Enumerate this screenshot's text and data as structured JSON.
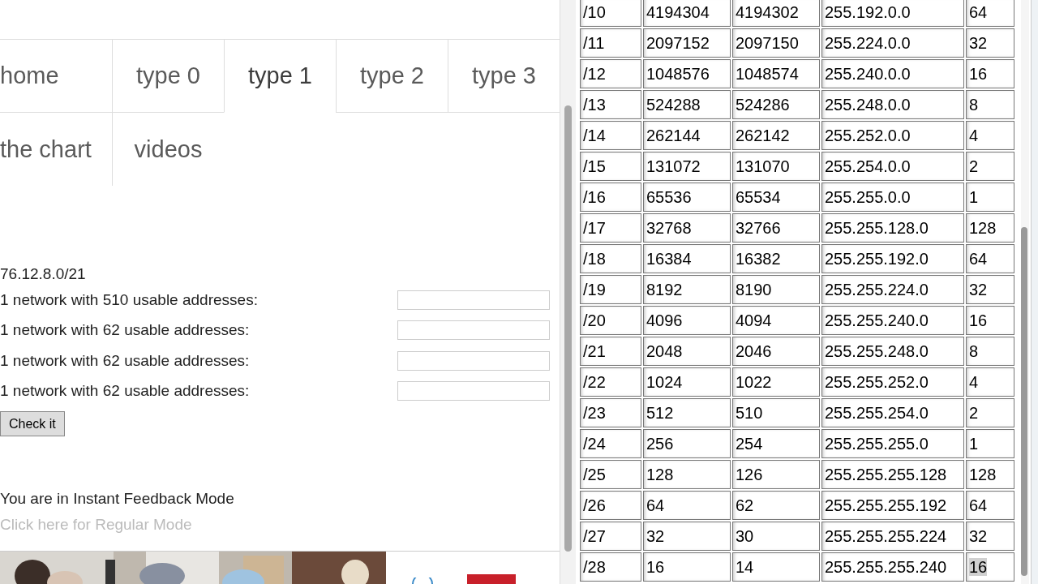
{
  "nav": {
    "tabs": [
      {
        "label": "home",
        "selected": false
      },
      {
        "label": "type 0",
        "selected": false
      },
      {
        "label": "type 1",
        "selected": true
      },
      {
        "label": "type 2",
        "selected": false
      },
      {
        "label": "type 3",
        "selected": false
      },
      {
        "label": "the chart",
        "selected": false
      },
      {
        "label": "videos",
        "selected": false
      }
    ]
  },
  "exercise": {
    "network": "76.12.8.0/21",
    "rows": [
      {
        "label": "1 network with 510 usable addresses:"
      },
      {
        "label": "1 network with 62 usable addresses:"
      },
      {
        "label": "1 network with 62 usable addresses:"
      },
      {
        "label": "1 network with 62 usable addresses:"
      }
    ],
    "button": "Check it",
    "mode_text": "You are in Instant Feedback Mode",
    "mode_link": "Click here for Regular Mode"
  },
  "subnet_table": {
    "rows": [
      {
        "cells": [
          "/10",
          "4194304",
          "4194302",
          "255.192.0.0",
          "64"
        ],
        "highlighted": false
      },
      {
        "cells": [
          "/11",
          "2097152",
          "2097150",
          "255.224.0.0",
          "32"
        ],
        "highlighted": false
      },
      {
        "cells": [
          "/12",
          "1048576",
          "1048574",
          "255.240.0.0",
          "16"
        ],
        "highlighted": false
      },
      {
        "cells": [
          "/13",
          "524288",
          "524286",
          "255.248.0.0",
          "8"
        ],
        "highlighted": false
      },
      {
        "cells": [
          "/14",
          "262144",
          "262142",
          "255.252.0.0",
          "4"
        ],
        "highlighted": false
      },
      {
        "cells": [
          "/15",
          "131072",
          "131070",
          "255.254.0.0",
          "2"
        ],
        "highlighted": false
      },
      {
        "cells": [
          "/16",
          "65536",
          "65534",
          "255.255.0.0",
          "1"
        ],
        "highlighted": false
      },
      {
        "cells": [
          "/17",
          "32768",
          "32766",
          "255.255.128.0",
          "128"
        ],
        "highlighted": false
      },
      {
        "cells": [
          "/18",
          "16384",
          "16382",
          "255.255.192.0",
          "64"
        ],
        "highlighted": false
      },
      {
        "cells": [
          "/19",
          "8192",
          "8190",
          "255.255.224.0",
          "32"
        ],
        "highlighted": false
      },
      {
        "cells": [
          "/20",
          "4096",
          "4094",
          "255.255.240.0",
          "16"
        ],
        "highlighted": false
      },
      {
        "cells": [
          "/21",
          "2048",
          "2046",
          "255.255.248.0",
          "8"
        ],
        "highlighted": false
      },
      {
        "cells": [
          "/22",
          "1024",
          "1022",
          "255.255.252.0",
          "4"
        ],
        "highlighted": false
      },
      {
        "cells": [
          "/23",
          "512",
          "510",
          "255.255.254.0",
          "2"
        ],
        "highlighted": false
      },
      {
        "cells": [
          "/24",
          "256",
          "254",
          "255.255.255.0",
          "1"
        ],
        "highlighted": false
      },
      {
        "cells": [
          "/25",
          "128",
          "126",
          "255.255.255.128",
          "128"
        ],
        "highlighted": false
      },
      {
        "cells": [
          "/26",
          "64",
          "62",
          "255.255.255.192",
          "64"
        ],
        "highlighted": false
      },
      {
        "cells": [
          "/27",
          "32",
          "30",
          "255.255.255.224",
          "32"
        ],
        "highlighted": false
      },
      {
        "cells": [
          "/28",
          "16",
          "14",
          "255.255.255.240",
          "16"
        ],
        "highlighted": true
      }
    ]
  }
}
